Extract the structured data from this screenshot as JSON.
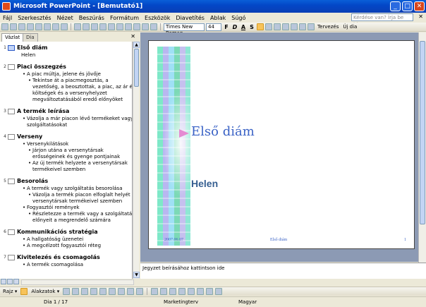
{
  "window": {
    "title": "Microsoft PowerPoint - [Bemutató1]",
    "buttons": [
      "_",
      "□",
      "✕"
    ]
  },
  "menu": {
    "items": [
      "Fájl",
      "Szerkesztés",
      "Nézet",
      "Beszúrás",
      "Formátum",
      "Eszközök",
      "Diavetítés",
      "Ablak",
      "Súgó"
    ],
    "help_placeholder": "Kérdése van? Írja be ide.",
    "close": "✕"
  },
  "toolbar": {
    "font_name": "Times New Roman",
    "font_size": "44",
    "bold": "F",
    "italic": "D",
    "underline": "A",
    "shadow": "S",
    "design_label": "Tervezés",
    "new_slide_label": "Új dia"
  },
  "pane": {
    "tab_outline": "Vázlat",
    "tab_slides": "Dia",
    "close": "✕"
  },
  "outline": {
    "slides": [
      {
        "num": "1",
        "title": "Első diám",
        "lines": [
          {
            "lvl": 0,
            "text": "Helen",
            "bullet": false
          }
        ]
      },
      {
        "num": "2",
        "title": "Piaci összegzés",
        "lines": [
          {
            "lvl": 1,
            "text": "A piac múltja, jelene és jövője",
            "bullet": true
          },
          {
            "lvl": 2,
            "text": "Tekintse át a piacmegosztás, a",
            "bullet": true
          },
          {
            "lvl": 2,
            "text": "vezetőség, a beosztottak, a piac, az ár és",
            "bullet": false
          },
          {
            "lvl": 2,
            "text": "költségek és a versenyhelyzet",
            "bullet": false
          },
          {
            "lvl": 2,
            "text": "megváltoztatásából eredő előnyöket",
            "bullet": false
          }
        ]
      },
      {
        "num": "3",
        "title": "A termék leírása",
        "lines": [
          {
            "lvl": 1,
            "text": "Vázolja a már piacon lévő termékeket vagy",
            "bullet": true
          },
          {
            "lvl": 1,
            "text": "szolgáltatásokat",
            "bullet": false
          }
        ]
      },
      {
        "num": "4",
        "title": "Verseny",
        "lines": [
          {
            "lvl": 1,
            "text": "Versenykilátások",
            "bullet": true
          },
          {
            "lvl": 2,
            "text": "Járjon utána a versenytársak",
            "bullet": true
          },
          {
            "lvl": 2,
            "text": "erősségeinek és gyenge pontjainak",
            "bullet": false
          },
          {
            "lvl": 2,
            "text": "Az új termék helyzete a versenytársak",
            "bullet": true
          },
          {
            "lvl": 2,
            "text": "termékeivel szemben",
            "bullet": false
          }
        ]
      },
      {
        "num": "5",
        "title": "Besorolás",
        "lines": [
          {
            "lvl": 1,
            "text": "A termék vagy szolgáltatás besorolása",
            "bullet": true
          },
          {
            "lvl": 2,
            "text": "Vázolja a termék piacon elfoglalt helyét a",
            "bullet": true
          },
          {
            "lvl": 2,
            "text": "versenytársak termékeivel szemben",
            "bullet": false
          },
          {
            "lvl": 1,
            "text": "Fogyasztói remények",
            "bullet": true
          },
          {
            "lvl": 2,
            "text": "Részletezze a termék vagy a szolgáltatás",
            "bullet": true
          },
          {
            "lvl": 2,
            "text": "előnyeit a megrendelő számára",
            "bullet": false
          }
        ]
      },
      {
        "num": "6",
        "title": "Kommunikációs stratégia",
        "lines": [
          {
            "lvl": 1,
            "text": "A hallgatóság üzenetei",
            "bullet": true
          },
          {
            "lvl": 1,
            "text": "A megcélzott fogyasztói réteg",
            "bullet": true
          }
        ]
      },
      {
        "num": "7",
        "title": "Kivitelezés és csomagolás",
        "lines": [
          {
            "lvl": 1,
            "text": "A termék csomagolása",
            "bullet": true
          }
        ]
      }
    ]
  },
  "slide": {
    "title": "Első diám",
    "subtitle": "Helen",
    "footer_date": "2007.06.07",
    "footer_text": "Első diám",
    "footer_num": "1"
  },
  "notes": {
    "placeholder": "Jegyzet beírásához kattintson ide"
  },
  "drawing": {
    "draw_label": "Rajz ▾",
    "autoshapes_label": "Alakzatok ▾"
  },
  "status": {
    "slide_info": "Dia 1 / 17",
    "design": "Marketingterv",
    "language": "Magyar"
  }
}
